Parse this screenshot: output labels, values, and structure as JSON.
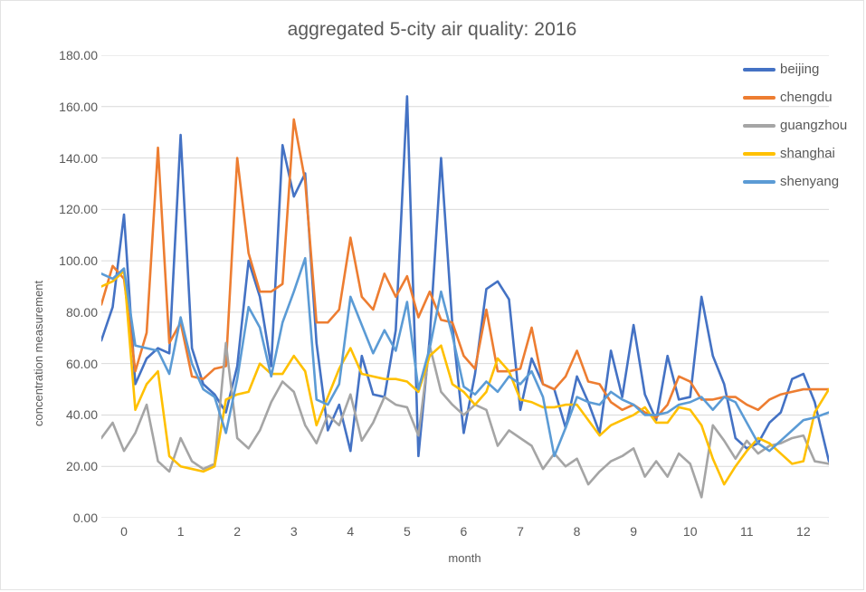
{
  "chart_data": {
    "type": "line",
    "title": "aggregated 5-city air quality: 2016",
    "xlabel": "month",
    "ylabel": "concentration measurement",
    "xlim": [
      -0.4,
      12.45
    ],
    "ylim": [
      0,
      180
    ],
    "ytick_labels": [
      "0.00",
      "20.00",
      "40.00",
      "60.00",
      "80.00",
      "100.00",
      "120.00",
      "140.00",
      "160.00",
      "180.00"
    ],
    "ytick_values": [
      0,
      20,
      40,
      60,
      80,
      100,
      120,
      140,
      160,
      180
    ],
    "xtick_labels": [
      "0",
      "1",
      "2",
      "3",
      "4",
      "5",
      "6",
      "7",
      "8",
      "9",
      "10",
      "11",
      "12"
    ],
    "xtick_values": [
      0,
      1,
      2,
      3,
      4,
      5,
      6,
      7,
      8,
      9,
      10,
      11,
      12
    ],
    "grid": "horizontal",
    "legend_position": "right",
    "x": [
      -0.4,
      -0.2,
      0.0,
      0.2,
      0.4,
      0.6,
      0.8,
      1.0,
      1.2,
      1.4,
      1.6,
      1.8,
      2.0,
      2.2,
      2.4,
      2.6,
      2.8,
      3.0,
      3.2,
      3.4,
      3.6,
      3.8,
      4.0,
      4.2,
      4.4,
      4.6,
      4.8,
      5.0,
      5.2,
      5.4,
      5.6,
      5.8,
      6.0,
      6.2,
      6.4,
      6.6,
      6.8,
      7.0,
      7.2,
      7.4,
      7.6,
      7.8,
      8.0,
      8.2,
      8.4,
      8.6,
      8.8,
      9.0,
      9.2,
      9.4,
      9.6,
      9.8,
      10.0,
      10.2,
      10.4,
      10.6,
      10.8,
      11.0,
      11.2,
      11.4,
      11.6,
      11.8,
      12.0,
      12.2,
      12.45
    ],
    "series": [
      {
        "name": "beijing",
        "color": "#4472C4",
        "values": [
          69,
          82,
          118,
          52,
          62,
          66,
          64,
          149,
          66,
          52,
          48,
          41,
          59,
          100,
          86,
          59,
          145,
          125,
          134,
          68,
          34,
          44,
          26,
          63,
          48,
          47,
          73,
          164,
          24,
          70,
          140,
          75,
          33,
          56,
          89,
          92,
          85,
          42,
          62,
          52,
          50,
          35,
          55,
          45,
          33,
          65,
          47,
          75,
          48,
          38,
          63,
          46,
          47,
          86,
          63,
          52,
          31,
          27,
          29,
          37,
          41,
          54,
          56,
          45,
          22
        ]
      },
      {
        "name": "chengdu",
        "color": "#ED7D31",
        "values": [
          83,
          98,
          93,
          57,
          72,
          144,
          68,
          76,
          55,
          54,
          58,
          59,
          140,
          103,
          88,
          88,
          91,
          155,
          131,
          76,
          76,
          81,
          109,
          86,
          81,
          95,
          86,
          94,
          78,
          88,
          77,
          76,
          63,
          58,
          81,
          57,
          57,
          58,
          74,
          52,
          50,
          55,
          65,
          53,
          52,
          45,
          42,
          44,
          41,
          39,
          44,
          55,
          53,
          46,
          46,
          47,
          47,
          44,
          42,
          46,
          48,
          49,
          50,
          50,
          50
        ]
      },
      {
        "name": "guangzhou",
        "color": "#A5A5A5",
        "values": [
          31,
          37,
          26,
          33,
          44,
          22,
          18,
          31,
          22,
          19,
          21,
          68,
          31,
          27,
          34,
          45,
          53,
          49,
          36,
          29,
          40,
          36,
          48,
          30,
          37,
          47,
          44,
          43,
          32,
          67,
          49,
          44,
          40,
          44,
          42,
          28,
          34,
          31,
          28,
          19,
          25,
          20,
          23,
          13,
          18,
          22,
          24,
          27,
          16,
          22,
          16,
          25,
          21,
          8,
          36,
          30,
          23,
          30,
          25,
          28,
          29,
          31,
          32,
          22,
          21
        ]
      },
      {
        "name": "shanghai",
        "color": "#FFC000",
        "values": [
          90,
          92,
          96,
          42,
          52,
          57,
          24,
          20,
          19,
          18,
          20,
          46,
          48,
          49,
          60,
          56,
          56,
          63,
          57,
          36,
          47,
          58,
          66,
          56,
          55,
          54,
          54,
          53,
          49,
          63,
          67,
          52,
          49,
          44,
          49,
          62,
          57,
          46,
          45,
          43,
          43,
          44,
          44,
          38,
          32,
          36,
          38,
          40,
          43,
          37,
          37,
          43,
          42,
          36,
          23,
          13,
          20,
          26,
          31,
          29,
          25,
          21,
          22,
          41,
          50
        ]
      },
      {
        "name": "shenyang",
        "color": "#5B9BD5",
        "values": [
          95,
          93,
          97,
          67,
          66,
          65,
          56,
          78,
          60,
          50,
          47,
          33,
          54,
          82,
          74,
          55,
          76,
          88,
          101,
          46,
          44,
          52,
          86,
          75,
          64,
          73,
          65,
          84,
          50,
          66,
          88,
          71,
          51,
          48,
          53,
          49,
          55,
          52,
          57,
          47,
          24,
          35,
          47,
          45,
          44,
          49,
          46,
          44,
          40,
          40,
          41,
          44,
          45,
          47,
          42,
          47,
          45,
          37,
          29,
          26,
          30,
          34,
          38,
          39,
          41
        ]
      }
    ]
  }
}
